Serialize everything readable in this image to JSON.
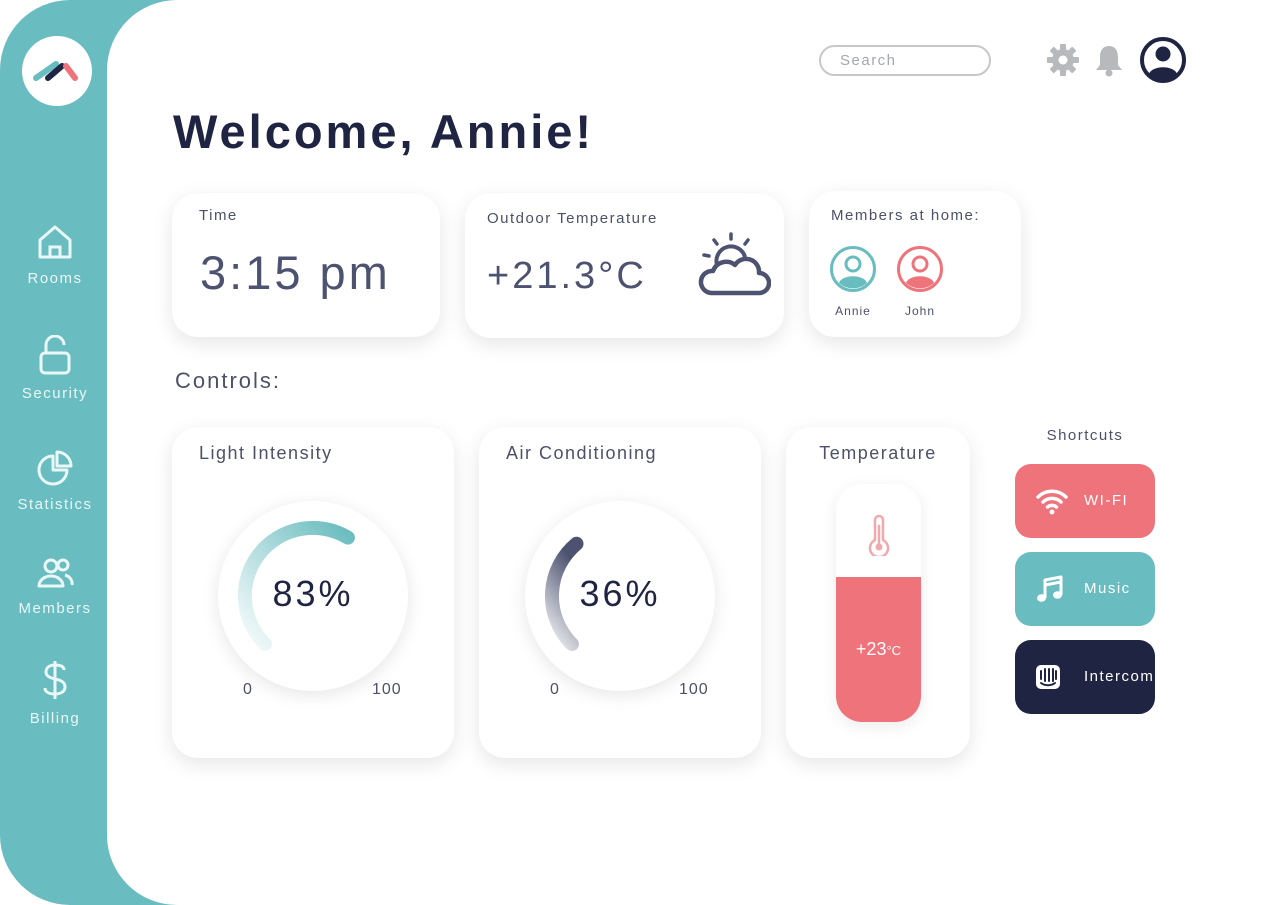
{
  "colors": {
    "teal": "#69bcbf",
    "coral": "#ee737b",
    "navy": "#1f2442",
    "slate": "#4c5270"
  },
  "sidebar": {
    "items": [
      {
        "label": "Rooms",
        "icon": "home-icon"
      },
      {
        "label": "Security",
        "icon": "unlock-icon"
      },
      {
        "label": "Statistics",
        "icon": "pie-chart-icon"
      },
      {
        "label": "Members",
        "icon": "users-icon"
      },
      {
        "label": "Billing",
        "icon": "dollar-icon"
      }
    ]
  },
  "header": {
    "search_placeholder": "Search",
    "icons": [
      "gear-icon",
      "bell-icon",
      "user-avatar-icon"
    ]
  },
  "welcome": "Welcome, Annie!",
  "time_card": {
    "label": "Time",
    "value": "3:15 pm"
  },
  "weather_card": {
    "label": "Outdoor Temperature",
    "value": "+21.3°C",
    "icon": "partly-cloudy-icon"
  },
  "members_card": {
    "label": "Members at home:",
    "members": [
      {
        "name": "Annie",
        "color": "#69bcbf"
      },
      {
        "name": "John",
        "color": "#ee737b"
      }
    ]
  },
  "controls_title": "Controls:",
  "light": {
    "label": "Light Intensity",
    "value": "83%",
    "level": 0.83,
    "min": "0",
    "max": "100"
  },
  "ac": {
    "label": "Air Conditioning",
    "value": "36%",
    "level": 0.36,
    "min": "0",
    "max": "100"
  },
  "temperature": {
    "label": "Temperature",
    "value": "+23",
    "unit": "°C",
    "icon": "thermometer-icon"
  },
  "shortcuts": {
    "title": "Shortcuts",
    "items": [
      {
        "label": "WI-FI",
        "icon": "wifi-icon",
        "color": "#ee737b"
      },
      {
        "label": "Music",
        "icon": "music-note-icon",
        "color": "#69bcbf"
      },
      {
        "label": "Intercom",
        "icon": "intercom-icon",
        "color": "#1f2442"
      }
    ]
  }
}
